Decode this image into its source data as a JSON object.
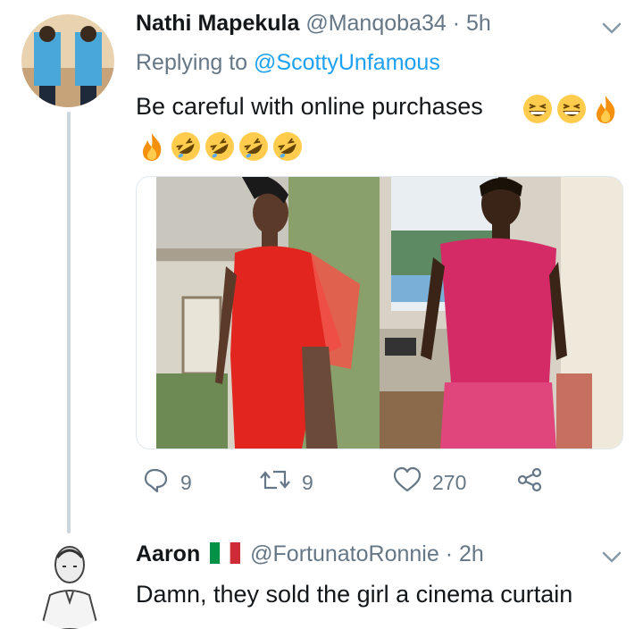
{
  "tweet": {
    "display_name": "Nathi Mapekula",
    "handle": "@Manqoba34",
    "separator": "·",
    "time": "5h",
    "replying_to_label": "Replying to",
    "replying_to_handle": "@ScottyUnfamous",
    "text": "Be careful with online purchases",
    "emoji_line1": [
      "grinning-squinting-emoji",
      "grinning-squinting-emoji",
      "fire-emoji"
    ],
    "emoji_line2": [
      "fire-emoji",
      "rolling-laughing-emoji",
      "rolling-laughing-emoji",
      "rolling-laughing-emoji",
      "rolling-laughing-emoji"
    ],
    "media": {
      "left": "red-dress-photo",
      "right": "pink-dress-photo"
    },
    "actions": {
      "reply_count": "9",
      "retweet_count": "9",
      "like_count": "270"
    }
  },
  "reply": {
    "display_name": "Aaron",
    "flag": "italy-flag",
    "handle": "@FortunatoRonnie",
    "separator": "·",
    "time": "2h",
    "text": "Damn, they sold the girl a cinema curtain"
  },
  "colors": {
    "text": "#14171a",
    "secondary": "#657786",
    "link": "#1da1f2",
    "thread_line": "#ccd6dd"
  }
}
